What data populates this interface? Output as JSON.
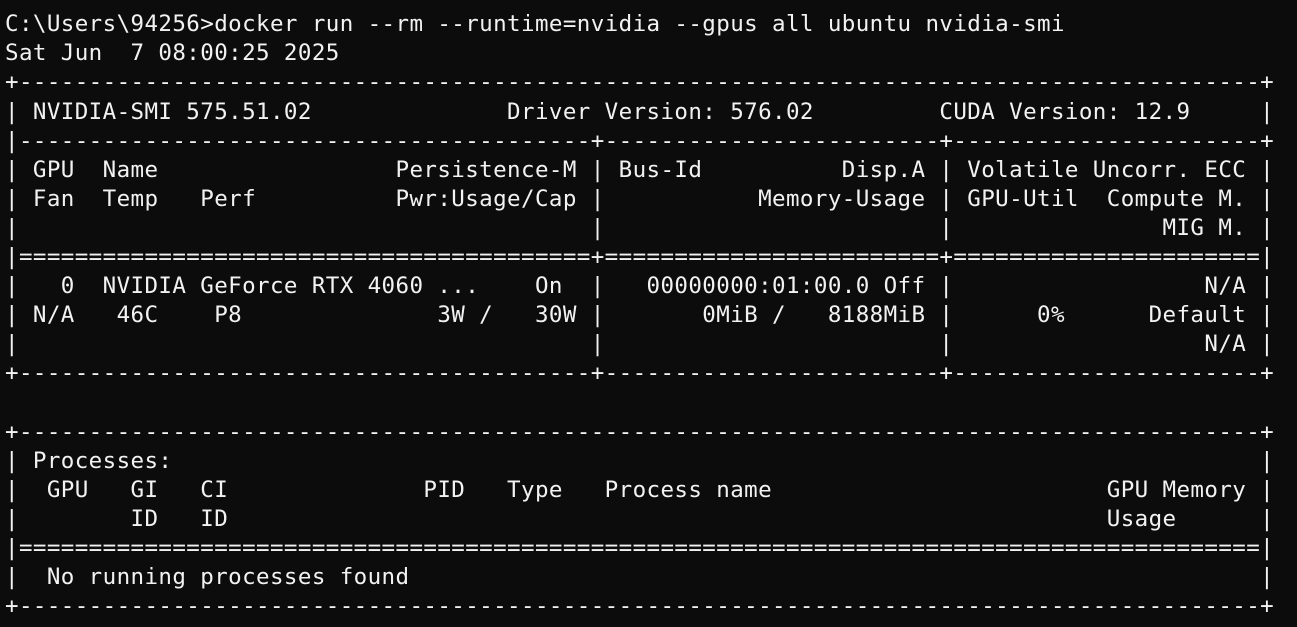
{
  "terminal": {
    "lines": [
      "C:\\Users\\94256>docker run --rm --runtime=nvidia --gpus all ubuntu nvidia-smi",
      "Sat Jun  7 08:00:25 2025",
      "+-----------------------------------------------------------------------------------------+",
      "| NVIDIA-SMI 575.51.02              Driver Version: 576.02         CUDA Version: 12.9     |",
      "|-----------------------------------------+------------------------+----------------------+",
      "| GPU  Name                 Persistence-M | Bus-Id          Disp.A | Volatile Uncorr. ECC |",
      "| Fan  Temp   Perf          Pwr:Usage/Cap |           Memory-Usage | GPU-Util  Compute M. |",
      "|                                         |                        |               MIG M. |",
      "|=========================================+========================+======================|",
      "|   0  NVIDIA GeForce RTX 4060 ...    On  |   00000000:01:00.0 Off |                  N/A |",
      "| N/A   46C    P8              3W /   30W |       0MiB /   8188MiB |      0%      Default |",
      "|                                         |                        |                  N/A |",
      "+-----------------------------------------+------------------------+----------------------+",
      "",
      "",
      "+-----------------------------------------------------------------------------------------+",
      "| Processes:                                                                              |",
      "|  GPU   GI   CI              PID   Type   Process name                        GPU Memory |",
      "|        ID   ID                                                               Usage      |",
      "|=========================================================================================|",
      "|  No running processes found                                                             |",
      "+-----------------------------------------------------------------------------------------+"
    ]
  }
}
